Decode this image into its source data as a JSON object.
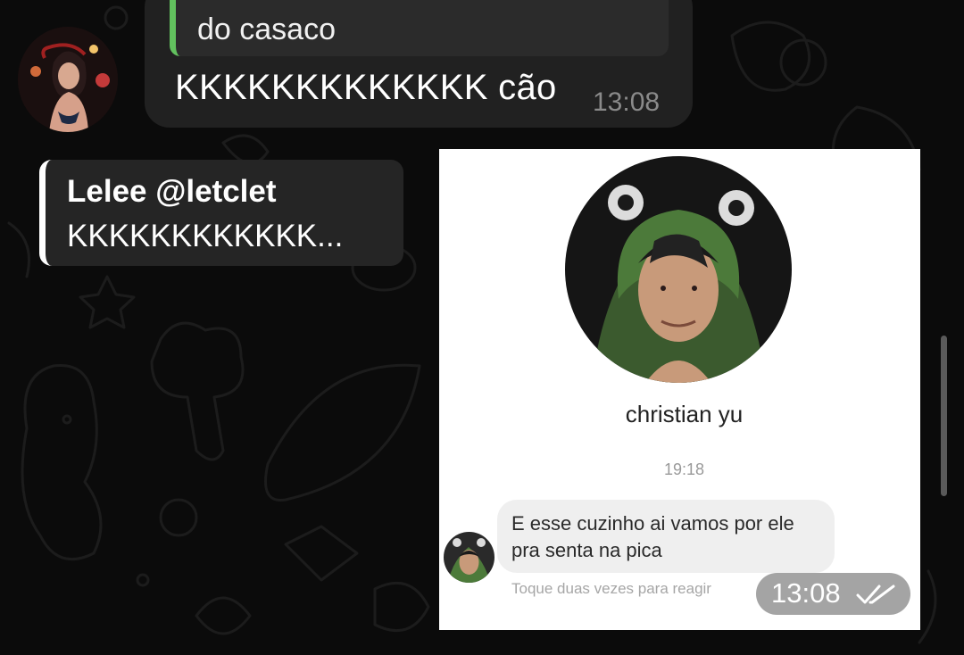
{
  "chat": {
    "quoted_message_text": "do casaco",
    "incoming_message_text": "KKKKKKKKKKKKK cão",
    "incoming_message_time": "13:08"
  },
  "reply": {
    "sender": "Lelee @letclet",
    "preview_text": "KKKKKKKKKKKK..."
  },
  "image_message": {
    "profile_name": "christian yu",
    "inner_timestamp": "19:18",
    "inner_message_line1": "E esse cuzinho ai vamos por ele",
    "inner_message_line2": "pra senta na pica",
    "inner_hint": "Toque duas vezes para reagir",
    "time": "13:08",
    "status_icon": "double-check-icon"
  },
  "colors": {
    "quote_accent": "#62c15e",
    "bubble_bg": "#212121",
    "background": "#0b0b0b"
  }
}
